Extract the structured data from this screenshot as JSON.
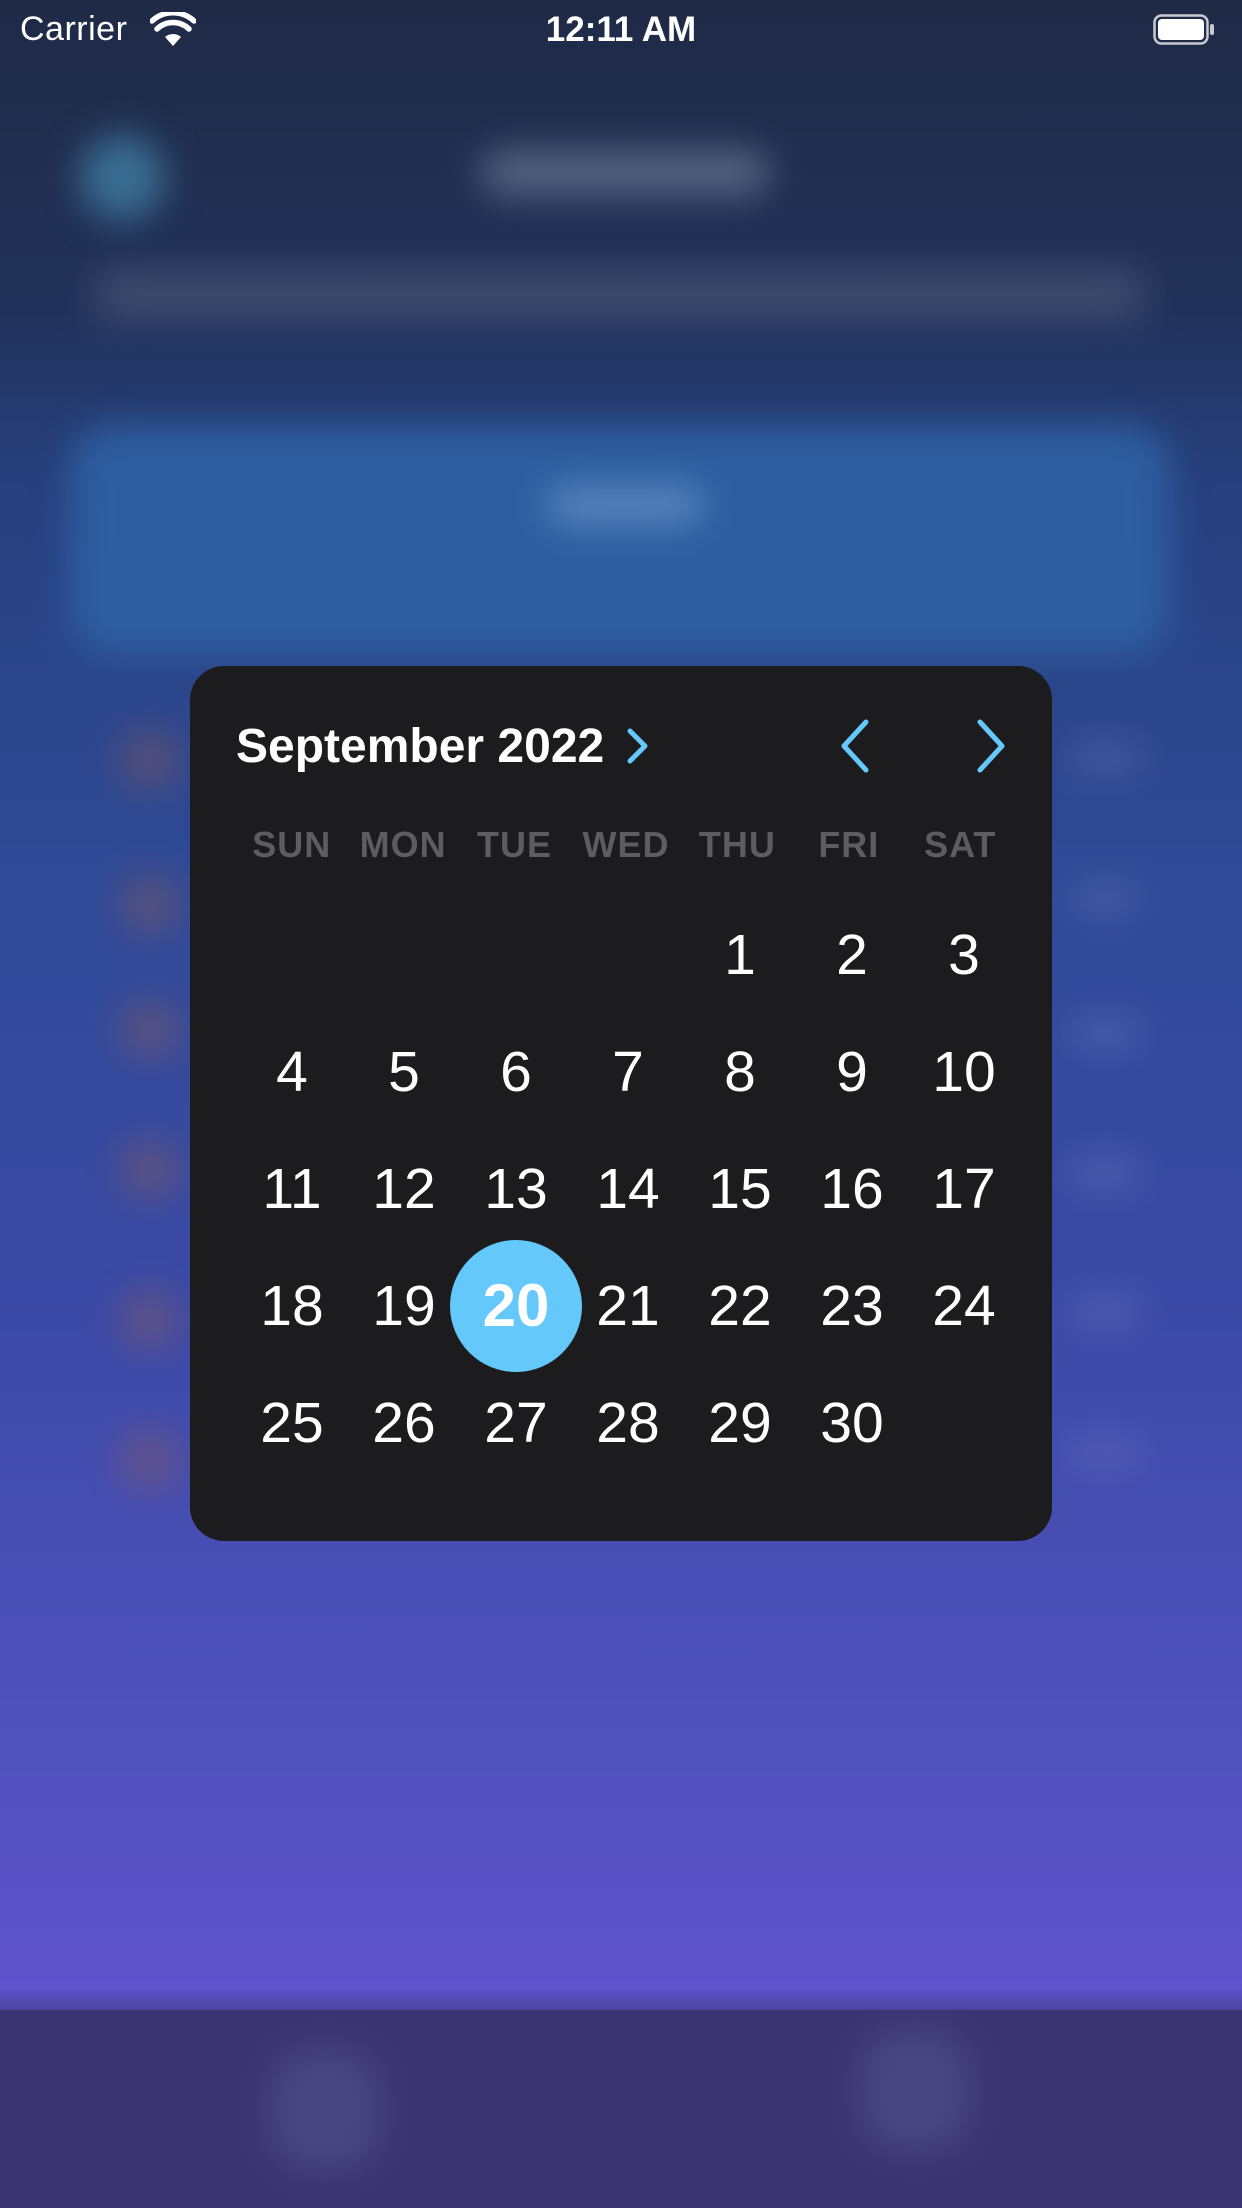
{
  "status_bar": {
    "carrier": "Carrier",
    "time": "12:11 AM",
    "wifi_icon": "wifi-icon",
    "battery_icon": "battery-icon"
  },
  "date_picker": {
    "month_label": "September 2022",
    "month_toggle_icon": "chevron-right-icon",
    "prev_month_icon": "chevron-left-icon",
    "next_month_icon": "chevron-right-icon",
    "weekdays": [
      "SUN",
      "MON",
      "TUE",
      "WED",
      "THU",
      "FRI",
      "SAT"
    ],
    "days": [
      "",
      "",
      "",
      "",
      "1",
      "2",
      "3",
      "4",
      "5",
      "6",
      "7",
      "8",
      "9",
      "10",
      "11",
      "12",
      "13",
      "14",
      "15",
      "16",
      "17",
      "18",
      "19",
      "20",
      "21",
      "22",
      "23",
      "24",
      "25",
      "26",
      "27",
      "28",
      "29",
      "30",
      ""
    ],
    "selected_day": "20",
    "accent_color": "#64c8fa",
    "background_color": "#1c1c1e"
  }
}
